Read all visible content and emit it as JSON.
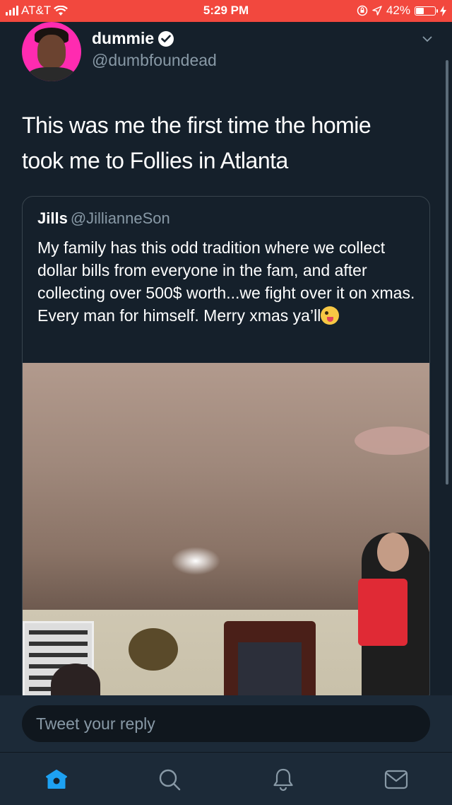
{
  "status_bar": {
    "carrier": "AT&T",
    "time": "5:29 PM",
    "battery_percent": "42%",
    "battery_level": 0.42
  },
  "tweet": {
    "display_name": "dummie",
    "handle": "@dumbfoundead",
    "text": "This was me the first time the homie took me to Follies in Atlanta"
  },
  "quoted_tweet": {
    "display_name": "Jills",
    "handle": "@JillianneSon",
    "text": "My family has this odd tradition where we collect dollar bills from everyone in the fam, and after collecting over 500$ worth...we fight over it on xmas. Every man for himself. Merry xmas ya’ll",
    "emoji": "zany-face-icon"
  },
  "reply": {
    "placeholder": "Tweet your reply"
  },
  "tab_bar": {
    "tabs": [
      {
        "icon": "home-icon",
        "active": true
      },
      {
        "icon": "search-icon",
        "active": false
      },
      {
        "icon": "notifications-bell-icon",
        "active": false
      },
      {
        "icon": "messages-envelope-icon",
        "active": false
      }
    ]
  },
  "colors": {
    "background": "#15202b",
    "status_bar": "#f2483e",
    "accent": "#1da1f2",
    "secondary_text": "#8899a6"
  }
}
